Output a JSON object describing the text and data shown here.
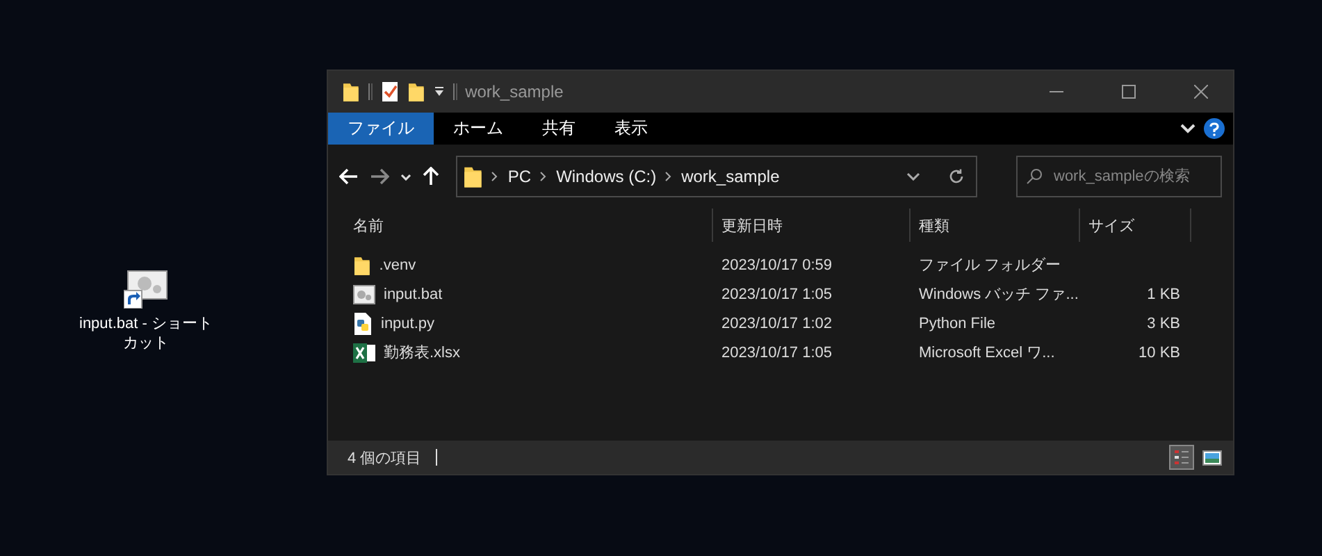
{
  "desktop_icons": [
    {
      "label": "input.bat - ショートカット",
      "kind": "batch-shortcut"
    }
  ],
  "window": {
    "title": "work_sample"
  },
  "ribbon_tabs": [
    {
      "label": "ファイル",
      "selected": true
    },
    {
      "label": "ホーム",
      "selected": false
    },
    {
      "label": "共有",
      "selected": false
    },
    {
      "label": "表示",
      "selected": false
    }
  ],
  "address": {
    "path": [
      "PC",
      "Windows (C:)",
      "work_sample"
    ]
  },
  "search": {
    "placeholder": "work_sampleの検索"
  },
  "columns": [
    "名前",
    "更新日時",
    "種類",
    "サイズ"
  ],
  "rows": [
    {
      "kind": "folder",
      "name": ".venv",
      "modified": "2023/10/17 0:59",
      "type": "ファイル フォルダー"
    },
    {
      "kind": "batch",
      "name": "input.bat",
      "modified": "2023/10/17 1:05",
      "type": "Windows バッチ ファ...",
      "size": "1 KB"
    },
    {
      "kind": "python",
      "name": "input.py",
      "modified": "2023/10/17 1:02",
      "type": "Python File",
      "size": "3 KB"
    },
    {
      "kind": "excel",
      "name": "勤務表.xlsx",
      "modified": "2023/10/17 1:05",
      "type": "Microsoft Excel ワ...",
      "size": "10 KB"
    }
  ],
  "status_bar": {
    "count": "4 個の項目",
    "views": [
      {
        "kind": "details",
        "selected": true
      },
      {
        "kind": "large-icons",
        "selected": false
      }
    ]
  }
}
